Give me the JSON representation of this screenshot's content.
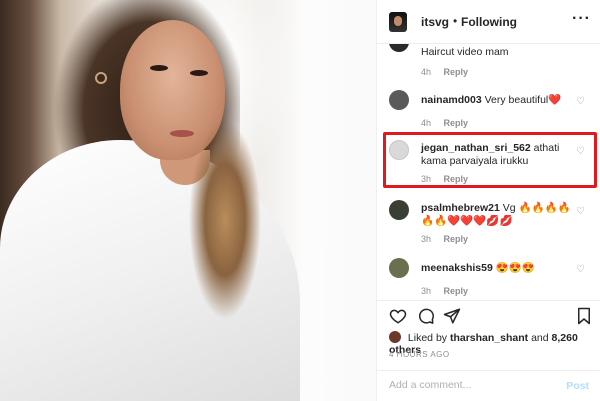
{
  "header": {
    "username": "itsvg",
    "separator": "•",
    "following": "Following",
    "more_icon": "more-horizontal-icon"
  },
  "comments": [
    {
      "username": "",
      "text": "Haircut video mam",
      "time": "4h",
      "reply": "Reply",
      "avatar_color": "#2a2a2a"
    },
    {
      "username": "nainamd003",
      "text": "Very beautiful❤️",
      "time": "4h",
      "reply": "Reply",
      "avatar_color": "#5a5a5a"
    },
    {
      "username": "jegan_nathan_sri_562",
      "text": "athati kama parvaiyala irukku",
      "time": "3h",
      "reply": "Reply",
      "avatar_color": "#d9d9d9",
      "highlighted": true,
      "highlight_color": "#e0191e"
    },
    {
      "username": "psalmhebrew21",
      "text": "Vg 🔥🔥🔥🔥🔥🔥❤️❤️❤️💋💋",
      "time": "3h",
      "reply": "Reply",
      "avatar_color": "#3a3f35"
    },
    {
      "username": "meenakshis59",
      "text": "😍😍😍",
      "time": "3h",
      "reply": "Reply",
      "avatar_color": "#6b6f4f"
    }
  ],
  "actions": {
    "like_icon": "heart-outline-icon",
    "comment_icon": "comment-icon",
    "share_icon": "send-icon",
    "save_icon": "bookmark-icon"
  },
  "likes": {
    "prefix": "Liked by",
    "user": "tharshan_shant",
    "connector": "and",
    "count": "8,260 others"
  },
  "time_ago": "4 HOURS AGO",
  "add_comment": {
    "placeholder": "Add a comment...",
    "post_label": "Post"
  }
}
